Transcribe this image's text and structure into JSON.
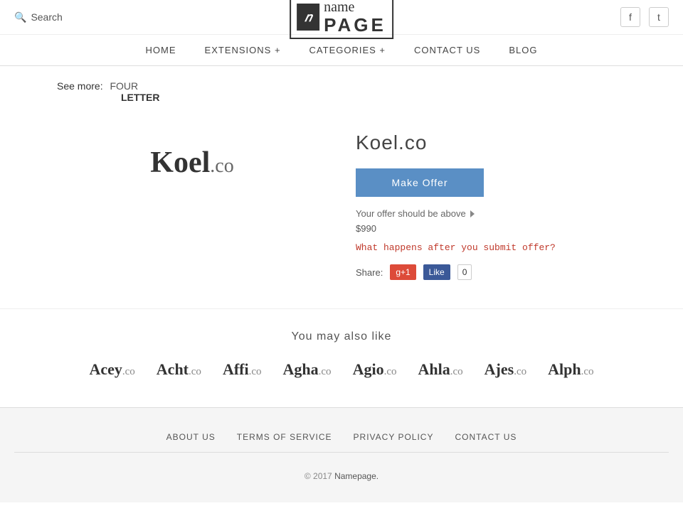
{
  "header": {
    "search_label": "Search",
    "facebook_icon": "f",
    "twitter_icon": "t",
    "logo_icon_letter": "n",
    "logo_name": "name",
    "logo_page": "PAGE"
  },
  "nav": {
    "items": [
      {
        "label": "HOME",
        "id": "home"
      },
      {
        "label": "EXTENSIONS +",
        "id": "extensions"
      },
      {
        "label": "CATEGORIES +",
        "id": "categories"
      },
      {
        "label": "CONTACT US",
        "id": "contact"
      },
      {
        "label": "BLOG",
        "id": "blog"
      }
    ]
  },
  "breadcrumb": {
    "see_more": "See more:",
    "tag1": "FOUR",
    "tag2": "LETTER"
  },
  "domain": {
    "name": "Koel",
    "ext": ".co",
    "full": "Koel.co",
    "make_offer_label": "Make Offer",
    "offer_hint": "Your offer should be above",
    "offer_price": "$990",
    "what_happens": "What happens after you submit offer?",
    "share_label": "Share:"
  },
  "share": {
    "gplus_label": "g+1",
    "fb_label": "Like",
    "fb_count": "0"
  },
  "also_like": {
    "title": "You may also like",
    "domains": [
      {
        "name": "Acey",
        "ext": ".co"
      },
      {
        "name": "Acht",
        "ext": ".co"
      },
      {
        "name": "Affi",
        "ext": ".co"
      },
      {
        "name": "Agha",
        "ext": ".co"
      },
      {
        "name": "Agio",
        "ext": ".co"
      },
      {
        "name": "Ahla",
        "ext": ".co"
      },
      {
        "name": "Ajes",
        "ext": ".co"
      },
      {
        "name": "Alph",
        "ext": ".co"
      }
    ]
  },
  "footer": {
    "links": [
      {
        "label": "ABOUT US",
        "id": "about"
      },
      {
        "label": "TERMS OF SERVICE",
        "id": "terms"
      },
      {
        "label": "PRIVACY POLICY",
        "id": "privacy"
      },
      {
        "label": "CONTACT US",
        "id": "contact"
      }
    ],
    "copy": "© 2017",
    "brand": "Namepage."
  }
}
